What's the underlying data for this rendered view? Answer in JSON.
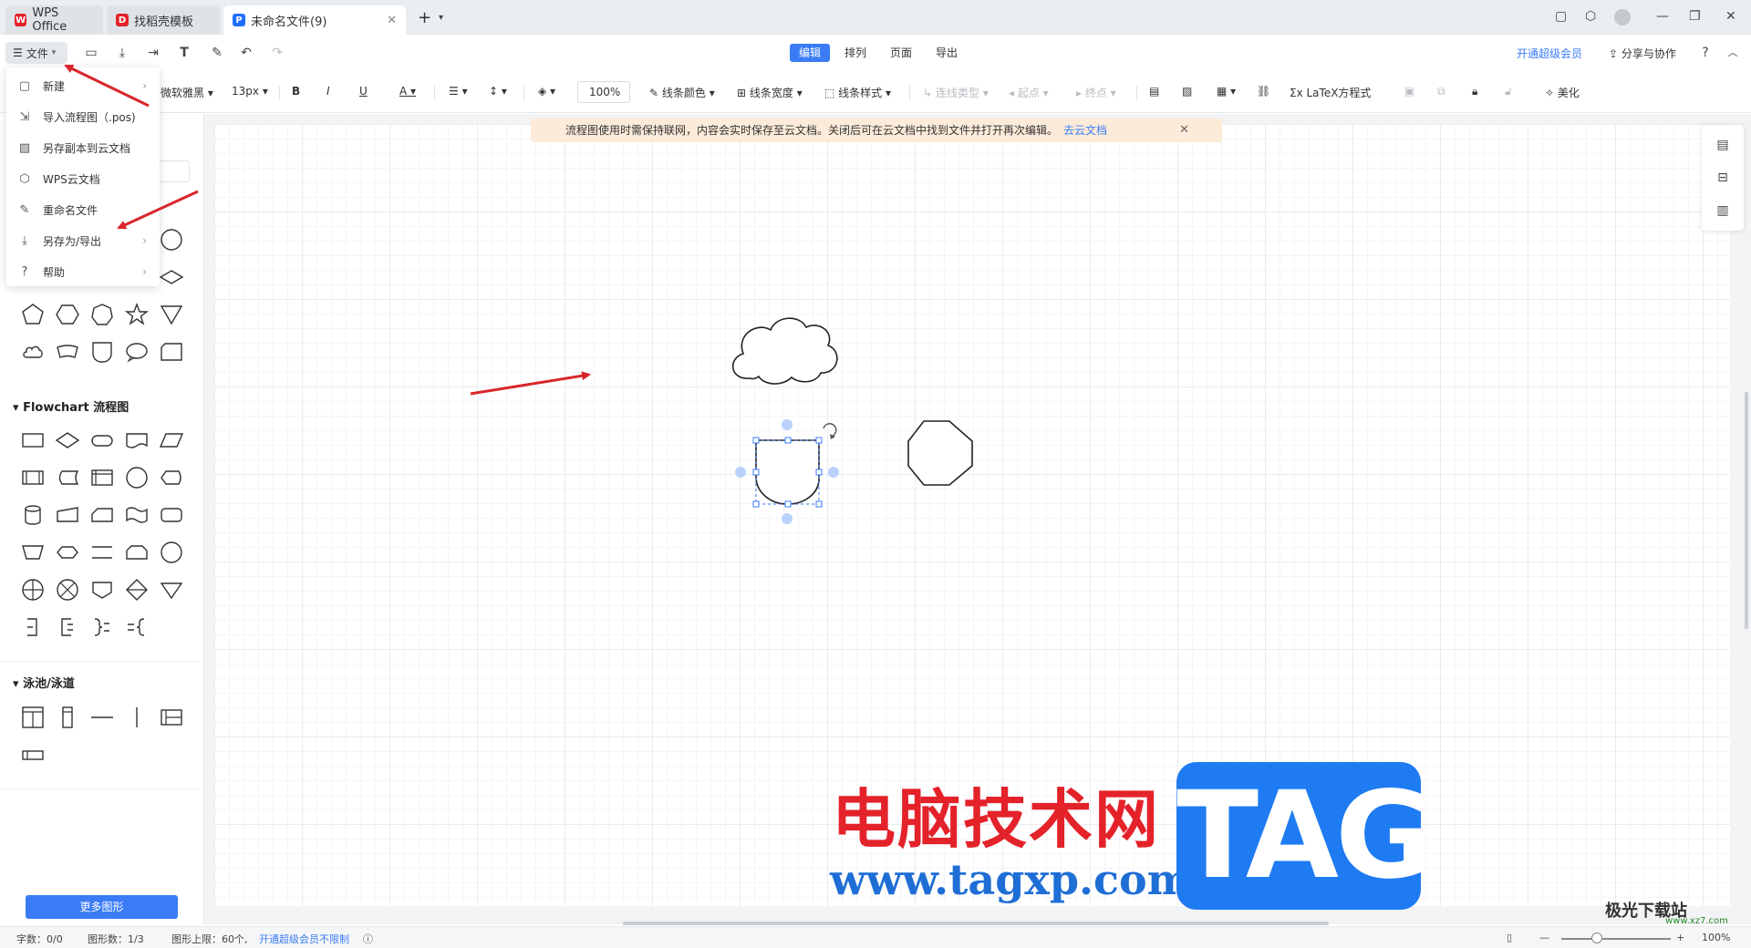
{
  "titlebar": {
    "tabs": [
      {
        "label": "WPS Office",
        "color": "#e4222a"
      },
      {
        "label": "找稻壳模板",
        "color": "#e4222a"
      },
      {
        "label": "未命名文件(9)",
        "color": "#1e6fff"
      }
    ],
    "new_tab": "+"
  },
  "toolbar1": {
    "file_label": "文件",
    "modes": [
      "编辑",
      "排列",
      "页面",
      "导出"
    ],
    "active_mode": "编辑",
    "vip_link": "开通超级会员",
    "share_label": "分享与协作"
  },
  "toolbar2": {
    "font_name": "微软雅黑",
    "font_size": "13px",
    "bold": "B",
    "italic": "I",
    "underline": "U",
    "font_color": "A",
    "zoom": "100%",
    "line_color": "线条颜色",
    "line_width": "线条宽度",
    "line_style": "线条样式",
    "connector_type": "连线类型",
    "start_point": "起点",
    "end_point": "终点",
    "latex": "LaTeX方程式",
    "beautify": "美化"
  },
  "filemenu": {
    "items": [
      {
        "label": "新建",
        "icon": "new-file-icon",
        "has_submenu": true
      },
      {
        "label": "导入流程图（.pos)",
        "icon": "import-icon",
        "has_submenu": false
      },
      {
        "label": "另存副本到云文档",
        "icon": "cloud-save-icon",
        "has_submenu": false
      },
      {
        "label": "WPS云文档",
        "icon": "cloud-doc-icon",
        "has_submenu": false
      },
      {
        "label": "重命名文件",
        "icon": "rename-icon",
        "has_submenu": false
      },
      {
        "label": "另存为/导出",
        "icon": "download-icon",
        "has_submenu": true
      },
      {
        "label": "帮助",
        "icon": "help-icon",
        "has_submenu": true
      }
    ]
  },
  "leftpanel": {
    "sections": [
      {
        "title": "Flowchart 流程图"
      },
      {
        "title": "泳池/泳道"
      }
    ],
    "more_shapes": "更多图形"
  },
  "notice": {
    "text": "流程图使用时需保持联网，内容会实时保存至云文档。关闭后可在云文档中找到文件并打开再次编辑。",
    "link": "去云文档"
  },
  "statusbar": {
    "word_count": "字数：0/0",
    "shape_count": "图形数：1/3",
    "shape_limit": "图形上限：60个,",
    "vip_unlimited": "开通超级会员不限制",
    "zoom": "100%"
  },
  "watermark": {
    "site_name": "电脑技术网",
    "site_url": "www.tagxp.com",
    "tag": "TAG",
    "brand2": "极光下载站",
    "brand2_url": "www.xz7.com"
  },
  "colors": {
    "accent": "#3b7cf6",
    "annotation_arrow": "#d9262b",
    "selection": "#3b7cf6"
  }
}
